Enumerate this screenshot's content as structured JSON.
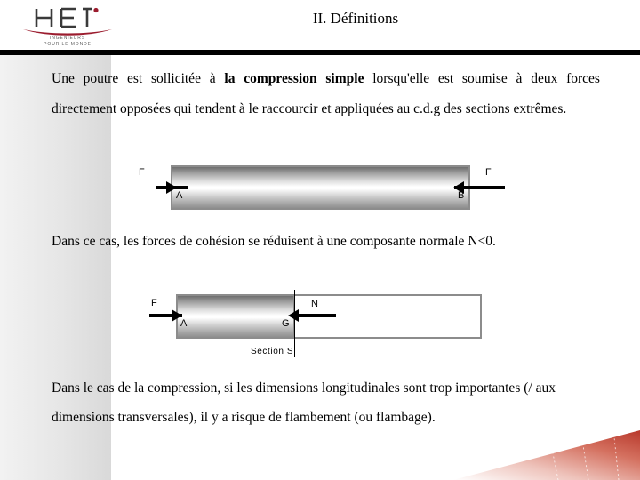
{
  "slide": {
    "title": "II. Définitions",
    "logo": {
      "name": "hei-logo",
      "wordmark": "HEI",
      "tagline_line1": "INGÉNIEURS",
      "tagline_line2": "POUR LE MONDE",
      "accent_color": "#9b1c2e"
    },
    "colors": {
      "rule": "#000000",
      "beam_border": "#8c8c8c",
      "corner_accent": "#c8483c",
      "left_strip": "#e6e6e6"
    }
  },
  "paragraphs": {
    "p1_part1": "Une poutre est sollicitée à ",
    "p1_bold": "la compression simple",
    "p1_part2": " lorsqu'elle est soumise à deux forces directement opposées qui tendent à le raccourcir et appliquées au c.d.g des sections extrêmes.",
    "p2": "Dans ce cas, les forces de cohésion se réduisent à une composante normale N<0.",
    "p3": "Dans le cas de la compression, si les dimensions longitudinales sont trop importantes (/ aux dimensions transversales), il y a risque de flambement (ou flambage)."
  },
  "figure1": {
    "name": "compression-beam-diagram",
    "force_left_label": "F",
    "force_right_label": "F",
    "point_left_label": "A",
    "point_right_label": "B"
  },
  "figure2": {
    "name": "cohesion-section-diagram",
    "force_left_label": "F",
    "normal_label": "N",
    "point_left_label": "A",
    "centroid_label": "G",
    "section_label": "Section S"
  }
}
